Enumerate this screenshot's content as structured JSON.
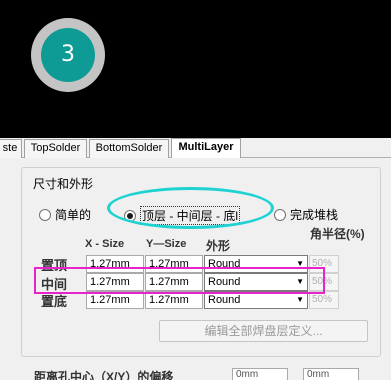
{
  "preview": {
    "pad_number": "3"
  },
  "tabs": [
    {
      "label": "ste",
      "active": false
    },
    {
      "label": "TopSolder",
      "active": false
    },
    {
      "label": "BottomSolder",
      "active": false
    },
    {
      "label": "MultiLayer",
      "active": true
    }
  ],
  "size_shape": {
    "group_title": "尺寸和外形",
    "options": [
      {
        "label": "简单的",
        "selected": false
      },
      {
        "label": "顶层 - 中间层 - 底l",
        "selected": true
      },
      {
        "label": "完成堆栈",
        "selected": false
      }
    ],
    "headers": {
      "x_size": "X - Size",
      "y_size": "Y—Size",
      "shape": "外形",
      "corner_radius": "角半径(%)"
    },
    "rows": [
      {
        "label": "置顶",
        "x": "1.27mm",
        "y": "1.27mm",
        "shape": "Round",
        "pct": "50%"
      },
      {
        "label": "中间",
        "x": "1.27mm",
        "y": "1.27mm",
        "shape": "Round",
        "pct": "50%"
      },
      {
        "label": "置底",
        "x": "1.27mm",
        "y": "1.27mm",
        "shape": "Round",
        "pct": "50%"
      }
    ],
    "edit_button": "编辑全部焊盘层定义..."
  },
  "offset": {
    "label": "距离孔中心（X/Y）的偏移",
    "x_value": "0mm",
    "y_value": "0mm"
  },
  "highlight_colors": {
    "ellipse": "#1fd2d2",
    "rect": "#e524c9"
  }
}
